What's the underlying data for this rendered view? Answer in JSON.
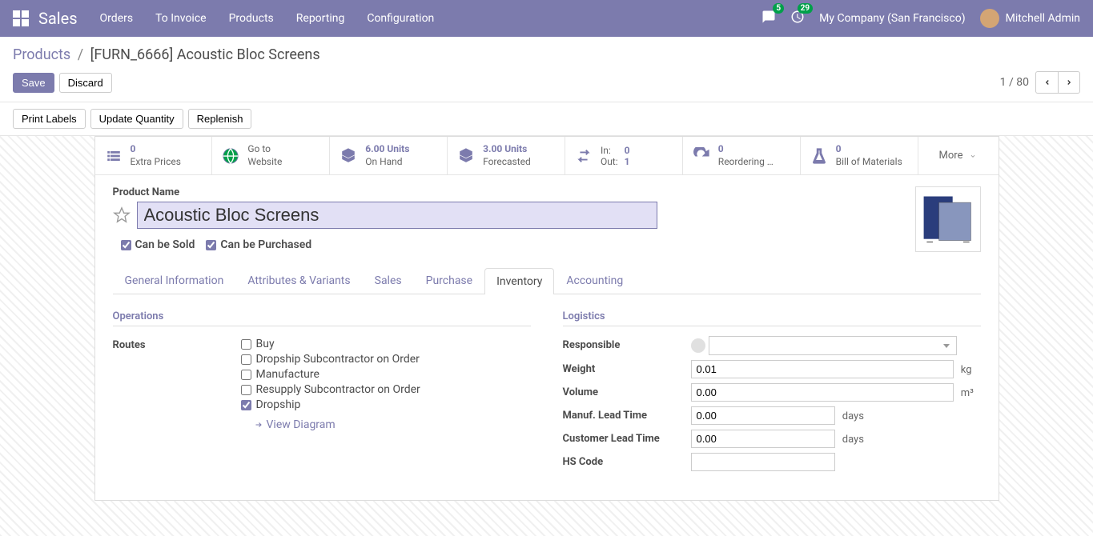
{
  "navbar": {
    "brand": "Sales",
    "menu": [
      "Orders",
      "To Invoice",
      "Products",
      "Reporting",
      "Configuration"
    ],
    "badge_messages": "5",
    "badge_activities": "29",
    "company": "My Company (San Francisco)",
    "user": "Mitchell Admin"
  },
  "breadcrumb": {
    "root": "Products",
    "current": "[FURN_6666] Acoustic Bloc Screens"
  },
  "buttons": {
    "save": "Save",
    "discard": "Discard",
    "print_labels": "Print Labels",
    "update_quantity": "Update Quantity",
    "replenish": "Replenish"
  },
  "pager": {
    "text": "1 / 80"
  },
  "stats": {
    "extra_prices": {
      "value": "0",
      "label": "Extra Prices"
    },
    "website": {
      "line1": "Go to",
      "line2": "Website"
    },
    "on_hand": {
      "value": "6.00 Units",
      "label": "On Hand"
    },
    "forecasted": {
      "value": "3.00 Units",
      "label": "Forecasted"
    },
    "transfers": {
      "in_label": "In:",
      "in_val": "0",
      "out_label": "Out:",
      "out_val": "1"
    },
    "reordering": {
      "value": "0",
      "label": "Reordering …"
    },
    "bom": {
      "value": "0",
      "label": "Bill of Materials"
    },
    "more": "More"
  },
  "product": {
    "name_label": "Product Name",
    "name": "Acoustic Bloc Screens",
    "can_be_sold": "Can be Sold",
    "can_be_purchased": "Can be Purchased"
  },
  "tabs": [
    "General Information",
    "Attributes & Variants",
    "Sales",
    "Purchase",
    "Inventory",
    "Accounting"
  ],
  "inventory": {
    "operations_title": "Operations",
    "routes_label": "Routes",
    "routes": {
      "buy": "Buy",
      "dropship_sub": "Dropship Subcontractor on Order",
      "manufacture": "Manufacture",
      "resupply_sub": "Resupply Subcontractor on Order",
      "dropship": "Dropship"
    },
    "view_diagram": "View Diagram",
    "logistics_title": "Logistics",
    "responsible_label": "Responsible",
    "weight_label": "Weight",
    "weight_value": "0.01",
    "weight_unit": "kg",
    "volume_label": "Volume",
    "volume_value": "0.00",
    "volume_unit": "m³",
    "manuf_lead_label": "Manuf. Lead Time",
    "manuf_lead_value": "0.00",
    "customer_lead_label": "Customer Lead Time",
    "customer_lead_value": "0.00",
    "days_unit": "days",
    "hs_code_label": "HS Code",
    "hs_code_value": ""
  }
}
